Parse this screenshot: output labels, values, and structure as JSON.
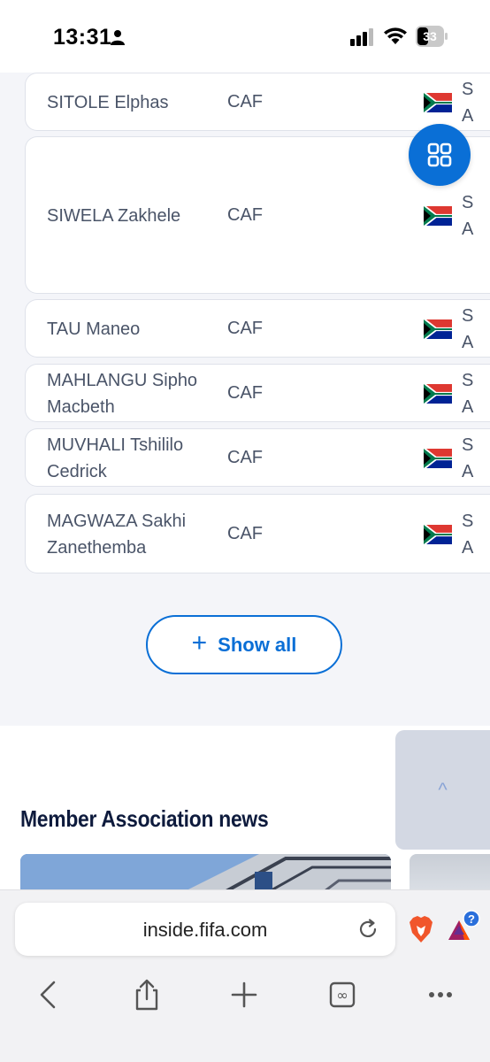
{
  "status": {
    "time": "13:31",
    "battery": "33"
  },
  "rows": [
    {
      "name": "SITOLE Elphas",
      "conf": "CAF",
      "country": "S A"
    },
    {
      "name": "SIWELA Zakhele",
      "conf": "CAF",
      "country": "S A"
    },
    {
      "name": "TAU Maneo",
      "conf": "CAF",
      "country": "S A"
    },
    {
      "name": "MAHLANGU Sipho Macbeth",
      "conf": "CAF",
      "country": "S A"
    },
    {
      "name": "MUVHALI Tshililo Cedrick",
      "conf": "CAF",
      "country": "S A"
    },
    {
      "name": "MAGWAZA Sakhi Zanethemba",
      "conf": "CAF",
      "country": "S A"
    }
  ],
  "show_all": "Show all",
  "news_title": "Member Association news",
  "to_top": "^",
  "browser": {
    "url": "inside.fifa.com",
    "badge": "?"
  },
  "icons": [
    "person-icon",
    "signal-icon",
    "wifi-icon",
    "battery-icon",
    "grid-icon",
    "flag-south-africa-icon",
    "plus-icon",
    "reload-icon",
    "brave-icon",
    "bat-icon",
    "back-icon",
    "share-icon",
    "new-tab-icon",
    "tabs-icon",
    "more-icon"
  ],
  "colors": {
    "accent": "#0a6fd6",
    "headline": "#0e1b3d",
    "text": "#4a5468"
  }
}
